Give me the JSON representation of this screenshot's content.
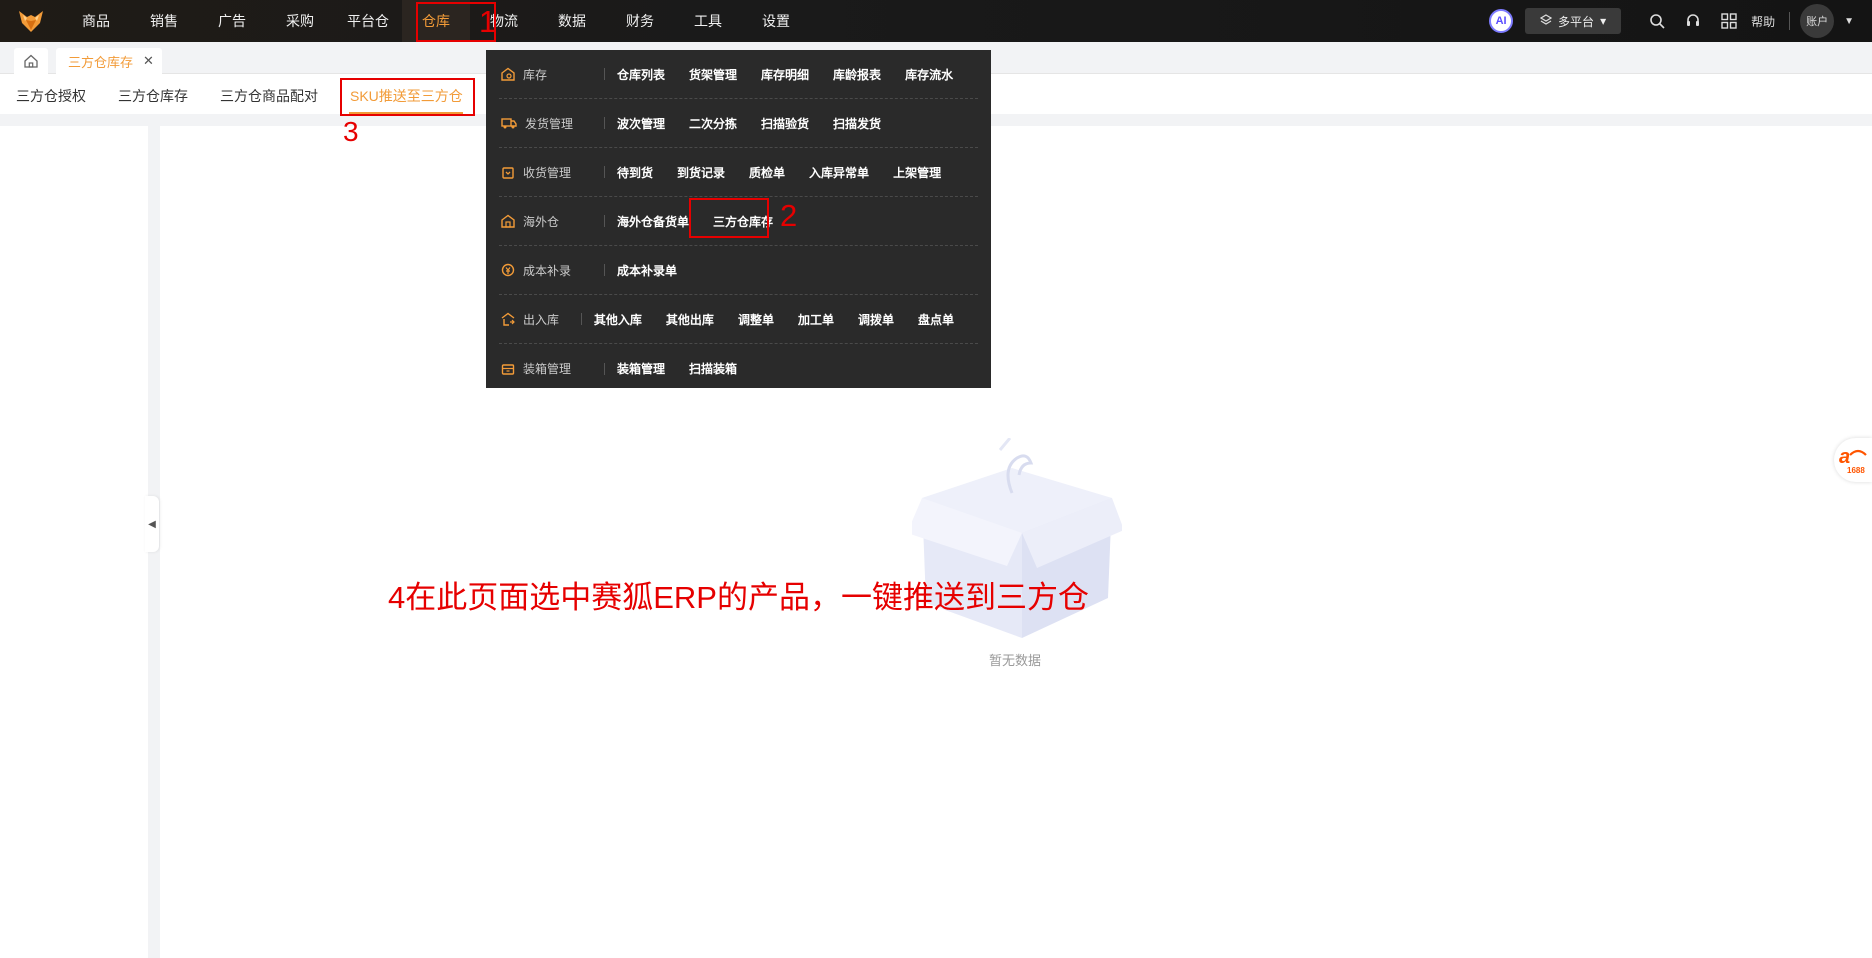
{
  "nav": {
    "items": [
      "商品",
      "销售",
      "广告",
      "采购",
      "平台仓",
      "仓库",
      "物流",
      "数据",
      "财务",
      "工具",
      "设置"
    ],
    "active_index": 5,
    "ai_label": "AI",
    "platform_label": "多平台",
    "help_label": "帮助",
    "account_label": "账户",
    "accent_color": "#f29b38"
  },
  "tabbar": {
    "current_tab": "三方仓库存",
    "close_glyph": "✕"
  },
  "subtabs": {
    "items": [
      "三方仓授权",
      "三方仓库存",
      "三方仓商品配对",
      "SKU推送至三方仓"
    ],
    "active_index": 3
  },
  "dropdown": {
    "rows": [
      {
        "category": "库存",
        "icon": "warehouse-icon",
        "links": [
          "仓库列表",
          "货架管理",
          "库存明细",
          "库龄报表",
          "库存流水"
        ]
      },
      {
        "category": "发货管理",
        "icon": "truck-icon",
        "links": [
          "波次管理",
          "二次分拣",
          "扫描验货",
          "扫描发货"
        ]
      },
      {
        "category": "收货管理",
        "icon": "box-icon",
        "links": [
          "待到货",
          "到货记录",
          "质检单",
          "入库异常单",
          "上架管理"
        ]
      },
      {
        "category": "海外仓",
        "icon": "overseas-warehouse-icon",
        "links": [
          "海外仓备货单",
          "三方仓库存"
        ]
      },
      {
        "category": "成本补录",
        "icon": "cost-icon",
        "links": [
          "成本补录单"
        ]
      },
      {
        "category": "出入库",
        "icon": "inout-icon",
        "links": [
          "其他入库",
          "其他出库",
          "调整单",
          "加工单",
          "调拨单",
          "盘点单"
        ]
      },
      {
        "category": "装箱管理",
        "icon": "packing-icon",
        "links": [
          "装箱管理",
          "扫描装箱"
        ]
      }
    ]
  },
  "empty_state": {
    "text": "暂无数据"
  },
  "annotations": {
    "n1": "1",
    "n2": "2",
    "n3": "3",
    "instruction": "4在此页面选中赛狐ERP的产品，一键推送到三方仓"
  },
  "side_widget": {
    "label": "1688"
  }
}
